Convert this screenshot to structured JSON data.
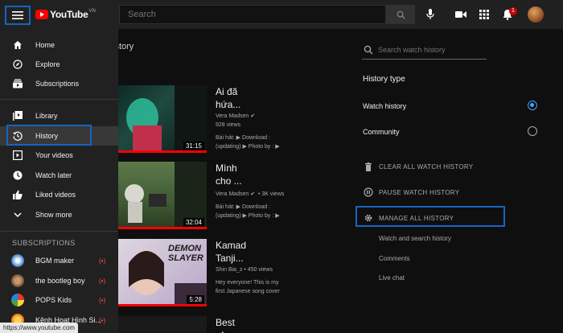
{
  "topbar": {
    "search_placeholder": "Search",
    "notification_count": "1"
  },
  "logo": {
    "text": "YouTube",
    "region": "VN"
  },
  "sidebar": {
    "main_items": [
      {
        "label": "Home",
        "icon": "home-icon"
      },
      {
        "label": "Explore",
        "icon": "explore-icon"
      },
      {
        "label": "Subscriptions",
        "icon": "subscriptions-icon"
      }
    ],
    "library_items": [
      {
        "label": "Library",
        "icon": "library-icon"
      },
      {
        "label": "History",
        "icon": "history-icon"
      },
      {
        "label": "Your videos",
        "icon": "your-videos-icon"
      },
      {
        "label": "Watch later",
        "icon": "watch-later-icon"
      },
      {
        "label": "Liked videos",
        "icon": "liked-videos-icon"
      },
      {
        "label": "Show more",
        "icon": "chevron-down-icon"
      }
    ],
    "subscriptions_heading": "SUBSCRIPTIONS",
    "subscriptions": [
      {
        "name": "BGM maker"
      },
      {
        "name": "the bootleg boy"
      },
      {
        "name": "POPS Kids"
      },
      {
        "name": "Kênh Hoạt Hình Si..."
      }
    ]
  },
  "main": {
    "heading": "istory",
    "videos": [
      {
        "title_l1": "Ai đã",
        "title_l2": "hứa...",
        "channel": "Vera Madsen",
        "views": "928 views",
        "desc_l1": "Bài hát: ▶ Download :",
        "desc_l2": "(updating) ▶ Photo by : ▶",
        "duration": "31:15"
      },
      {
        "title_l1": "Mình",
        "title_l2": "cho ...",
        "channel": "Vera Madsen",
        "views": "3K views",
        "desc_l1": "Bài hát: ▶ Download :",
        "desc_l2": "(updating) ▶ Photo by : ▶",
        "duration": "32:04"
      },
      {
        "title_l1": "Kamad",
        "title_l2": "Tanji...",
        "channel": "Shin Bia_z",
        "views": "450 views",
        "desc_l1": "Hey everyone! This is my",
        "desc_l2": "first Japanese song cover",
        "duration": "5:28",
        "thumb_text_1": "DEMON",
        "thumb_text_2": "SLAYER"
      },
      {
        "title_l1": "Best",
        "title_l2": "of"
      }
    ]
  },
  "right_panel": {
    "search_placeholder": "Search watch history",
    "history_type_heading": "History type",
    "options": [
      {
        "label": "Watch history",
        "selected": true
      },
      {
        "label": "Community",
        "selected": false
      }
    ],
    "actions": [
      {
        "label": "CLEAR ALL WATCH HISTORY",
        "icon": "trash-icon"
      },
      {
        "label": "PAUSE WATCH HISTORY",
        "icon": "pause-icon"
      },
      {
        "label": "MANAGE ALL HISTORY",
        "icon": "gear-icon"
      }
    ],
    "sub_links": [
      "Watch and search history",
      "Comments",
      "Live chat"
    ]
  },
  "status_bar": {
    "url": "https://www.youtube.com"
  },
  "colors": {
    "highlight": "#1565c0",
    "accent": "#3ea6ff",
    "brand": "#ff0000"
  }
}
